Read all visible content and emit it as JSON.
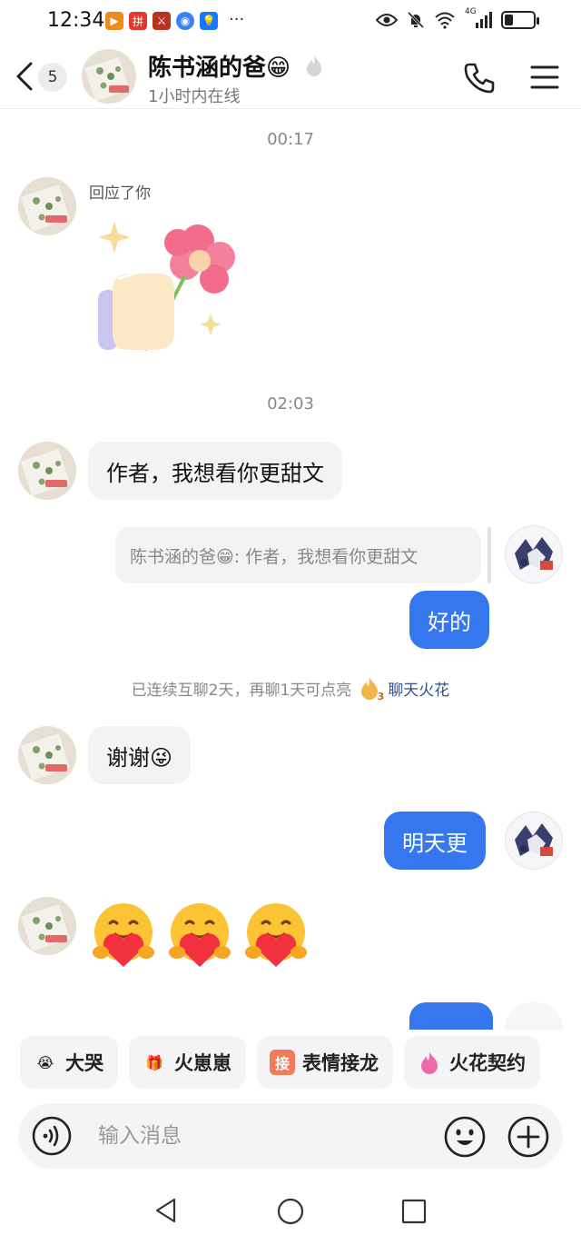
{
  "status_bar": {
    "time": "12:34",
    "more": "···",
    "network": "4G",
    "battery_level": 0.26
  },
  "header": {
    "back_label": "back",
    "unread_count": "5",
    "contact_name": "陈书涵的爸😁",
    "online_status": "1小时内在线"
  },
  "messages": [
    {
      "kind": "time",
      "text": "00:17"
    },
    {
      "kind": "reaction",
      "side": "in",
      "label": "回应了你",
      "sticker": "hand-holding-flower-sticker"
    },
    {
      "kind": "time",
      "text": "02:03"
    },
    {
      "kind": "text",
      "side": "in",
      "text": "作者，我想看你更甜文"
    },
    {
      "kind": "quote",
      "side": "out",
      "text": "陈书涵的爸😁: 作者，我想看你更甜文"
    },
    {
      "kind": "text",
      "side": "out",
      "text": "好的"
    },
    {
      "kind": "notice",
      "text": "已连续互聊2天，再聊1天可点亮",
      "link": "聊天火花",
      "flame_count": "3"
    },
    {
      "kind": "text",
      "side": "in",
      "text": "谢谢😜"
    },
    {
      "kind": "text",
      "side": "out",
      "text": "明天更"
    },
    {
      "kind": "emoji",
      "side": "in",
      "emojis": [
        "🥰",
        "🥰",
        "🥰"
      ]
    }
  ],
  "quick_replies": [
    {
      "label": "大哭",
      "icon": "crying-face-icon",
      "emoji": "😭"
    },
    {
      "label": "火崽崽",
      "icon": "fire-mascot-icon",
      "emoji": "🎁"
    },
    {
      "label": "表情接龙",
      "icon": "relay-icon",
      "emoji": "接"
    },
    {
      "label": "火花契约",
      "icon": "flame-icon",
      "emoji": "🔥"
    }
  ],
  "input": {
    "placeholder": "输入消息"
  },
  "colors": {
    "accent": "#3677f0",
    "bubble_in": "#f3f3f5",
    "link": "#2f4f8f"
  }
}
